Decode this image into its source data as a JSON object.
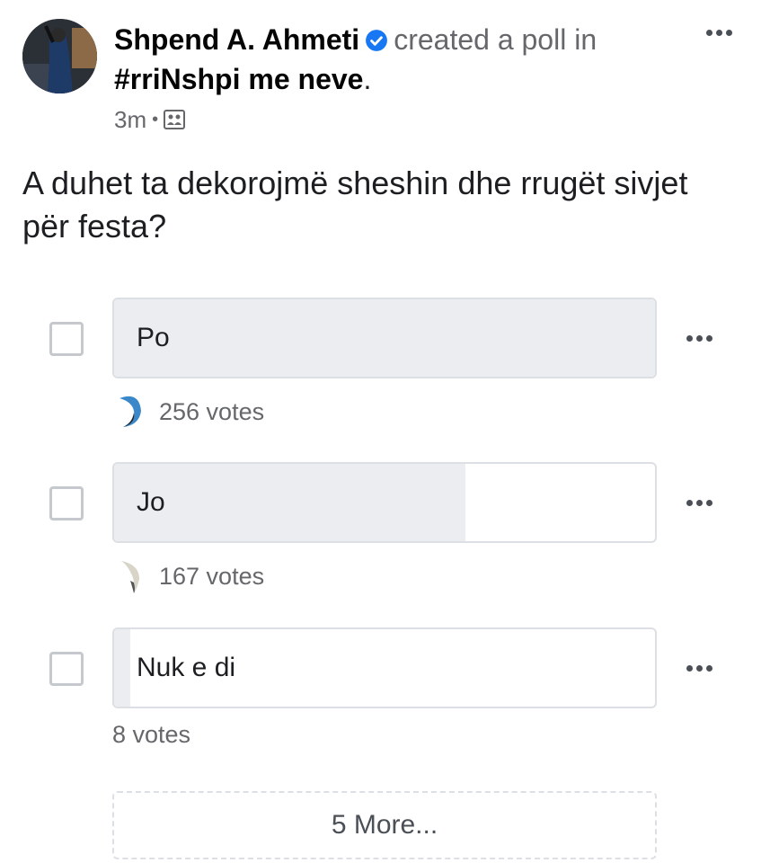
{
  "post": {
    "author": "Shpend A. Ahmeti",
    "action": "created a poll in",
    "group": "#rriNshpi me neve",
    "group_suffix": ".",
    "time": "3m",
    "separator": "•",
    "visibility_icon": "group-icon",
    "verified_icon": "verified-badge-icon",
    "more_icon": "more-horizontal-icon",
    "colors": {
      "verified": "#1877f2",
      "secondary_text": "#65676b",
      "bar_fill": "#ebedf0",
      "bar_border": "#dcdfe4"
    }
  },
  "poll": {
    "question": "A duhet ta dekorojmë sheshin dhe rrugët sivjet për festa?",
    "options": [
      {
        "label": "Po",
        "votes_text": "256 votes",
        "fill_fraction": 1.0,
        "has_voter_avatar": true
      },
      {
        "label": "Jo",
        "votes_text": "167 votes",
        "fill_fraction": 0.65,
        "has_voter_avatar": true
      },
      {
        "label": "Nuk e di",
        "votes_text": "8 votes",
        "fill_fraction": 0.03,
        "has_voter_avatar": false
      }
    ],
    "more_options_label": "5 More..."
  }
}
